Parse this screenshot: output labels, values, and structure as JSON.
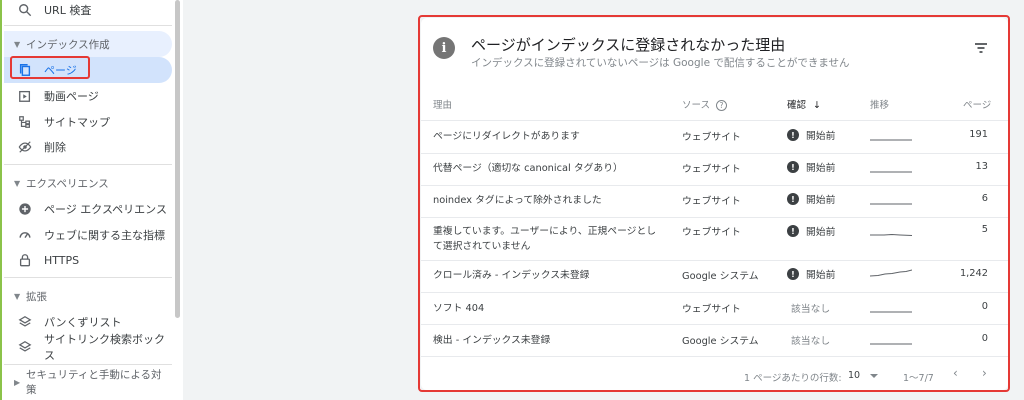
{
  "sidebar": {
    "url_inspection": "URL 検査",
    "index_section": "インデックス作成",
    "items_index": [
      {
        "label": "ページ",
        "icon": "pages-icon"
      },
      {
        "label": "動画ページ",
        "icon": "video-pages-icon"
      },
      {
        "label": "サイトマップ",
        "icon": "sitemap-icon"
      },
      {
        "label": "削除",
        "icon": "removals-icon"
      }
    ],
    "experience_section": "エクスペリエンス",
    "items_experience": [
      {
        "label": "ページ エクスペリエンス",
        "icon": "page-experience-icon"
      },
      {
        "label": "ウェブに関する主な指標",
        "icon": "core-web-vitals-icon"
      },
      {
        "label": "HTTPS",
        "icon": "lock-icon"
      }
    ],
    "enhancements_section": "拡張",
    "items_enhancements": [
      {
        "label": "パンくずリスト",
        "icon": "layers-icon"
      },
      {
        "label": "サイトリンク検索ボックス",
        "icon": "layers-icon"
      }
    ],
    "security_section": "セキュリティと手動による対策"
  },
  "card": {
    "title": "ページがインデックスに登録されなかった理由",
    "subtitle": "インデックスに登録されていないページは Google で配信することができません",
    "columns": {
      "reason": "理由",
      "source": "ソース",
      "validation": "確認",
      "trend": "推移",
      "pages": "ページ"
    },
    "rows": [
      {
        "reason": "ページにリダイレクトがあります",
        "source": "ウェブサイト",
        "status": "開始前",
        "pages": "191"
      },
      {
        "reason": "代替ページ（適切な canonical タグあり）",
        "source": "ウェブサイト",
        "status": "開始前",
        "pages": "13"
      },
      {
        "reason": "noindex タグによって除外されました",
        "source": "ウェブサイト",
        "status": "開始前",
        "pages": "6"
      },
      {
        "reason": "重複しています。ユーザーにより、正規ページとして選択されていません",
        "source": "ウェブサイト",
        "status": "開始前",
        "pages": "5"
      },
      {
        "reason": "クロール済み - インデックス未登録",
        "source": "Google システム",
        "status": "開始前",
        "pages": "1,242"
      },
      {
        "reason": "ソフト 404",
        "source": "ウェブサイト",
        "status": "該当なし",
        "pages": "0"
      },
      {
        "reason": "検出 - インデックス未登録",
        "source": "Google システム",
        "status": "該当なし",
        "pages": "0"
      }
    ],
    "pager": {
      "rows_per_page_label": "1 ページあたりの行数:",
      "rows_per_page": "10",
      "range": "1〜7/7"
    }
  },
  "colors": {
    "highlight_border": "#e53935",
    "selected_nav_bg": "#d2e3fc",
    "accent": "#1a73e8"
  }
}
